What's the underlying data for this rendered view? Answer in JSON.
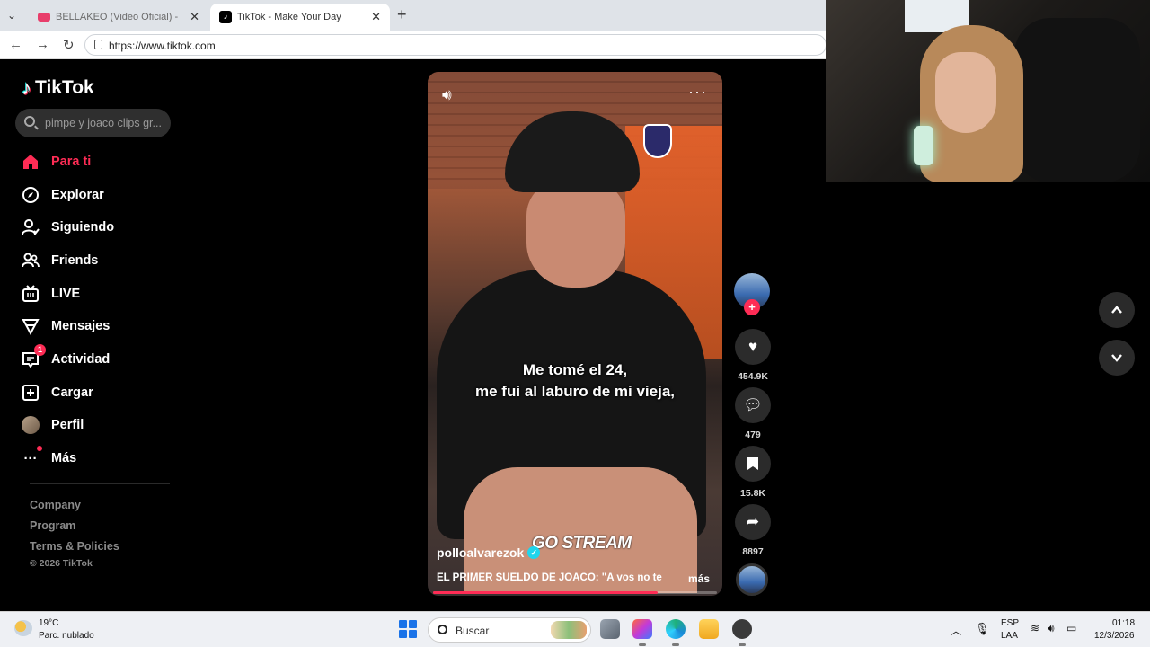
{
  "browser": {
    "tabs": [
      {
        "title": "BELLAKEO (Video Oficial) - Peso Pl",
        "active": false,
        "favicon": "youtube-icon"
      },
      {
        "title": "TikTok - Make Your Day",
        "active": true,
        "favicon": "tiktok-icon"
      }
    ],
    "url": "https://www.tiktok.com"
  },
  "tiktok": {
    "logo_text": "TikTok",
    "search_placeholder": "pimpe y joaco clips gr...",
    "nav": [
      {
        "label": "Para ti",
        "icon": "home-icon",
        "active": true
      },
      {
        "label": "Explorar",
        "icon": "compass-icon"
      },
      {
        "label": "Siguiendo",
        "icon": "following-icon"
      },
      {
        "label": "Friends",
        "icon": "friends-icon"
      },
      {
        "label": "LIVE",
        "icon": "live-icon"
      },
      {
        "label": "Mensajes",
        "icon": "messages-icon"
      },
      {
        "label": "Actividad",
        "icon": "activity-icon",
        "badge": "1"
      },
      {
        "label": "Cargar",
        "icon": "upload-icon"
      },
      {
        "label": "Perfil",
        "icon": "profile-avatar"
      },
      {
        "label": "Más",
        "icon": "more-icon"
      }
    ],
    "footer": {
      "links": [
        "Company",
        "Program",
        "Terms & Policies"
      ],
      "copyright": "© 2026 TikTok"
    },
    "video": {
      "caption_line1": "Me tomé el 24,",
      "caption_line2": "me fui al laburo de mi vieja,",
      "watermark": "GO STREAM",
      "author": "polloalvarezok",
      "description": "EL PRIMER SUELDO DE JOACO: \"A vos no te",
      "more_label": "más",
      "progress": 0.79
    },
    "actions": {
      "likes": "454.9K",
      "comments": "479",
      "saves": "15.8K",
      "shares": "8897"
    }
  },
  "taskbar": {
    "weather_temp": "19°C",
    "weather_desc": "Parc. nublado",
    "search_label": "Buscar",
    "lang_line1": "ESP",
    "lang_line2": "LAA",
    "time": "01:18",
    "date": "12/3/2026"
  },
  "colors": {
    "accent": "#fe2c55",
    "verified": "#20d5ec"
  }
}
